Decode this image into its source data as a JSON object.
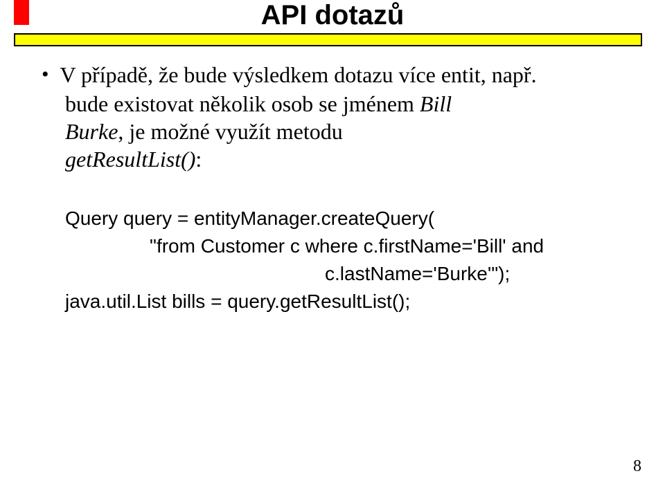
{
  "title": "API dotazů",
  "bullet": {
    "line1_prefix": "V případě, že bude výsledkem dotazu více entit, např.",
    "line2_part1": "bude existovat několik osob se jménem ",
    "line2_italic1": "Bill",
    "line3_italic": "Burke",
    "line3_mid": ", je možné využít metodu",
    "line4_italic": "getResultList()",
    "line4_end": ":"
  },
  "code": {
    "l1": "Query query = entityManager.createQuery(",
    "l2": "\"from Customer c where c.firstName='Bill' and",
    "l3": "c.lastName='Burke'\");",
    "l4": "java.util.List bills = query.getResultList();"
  },
  "page_number": "8"
}
